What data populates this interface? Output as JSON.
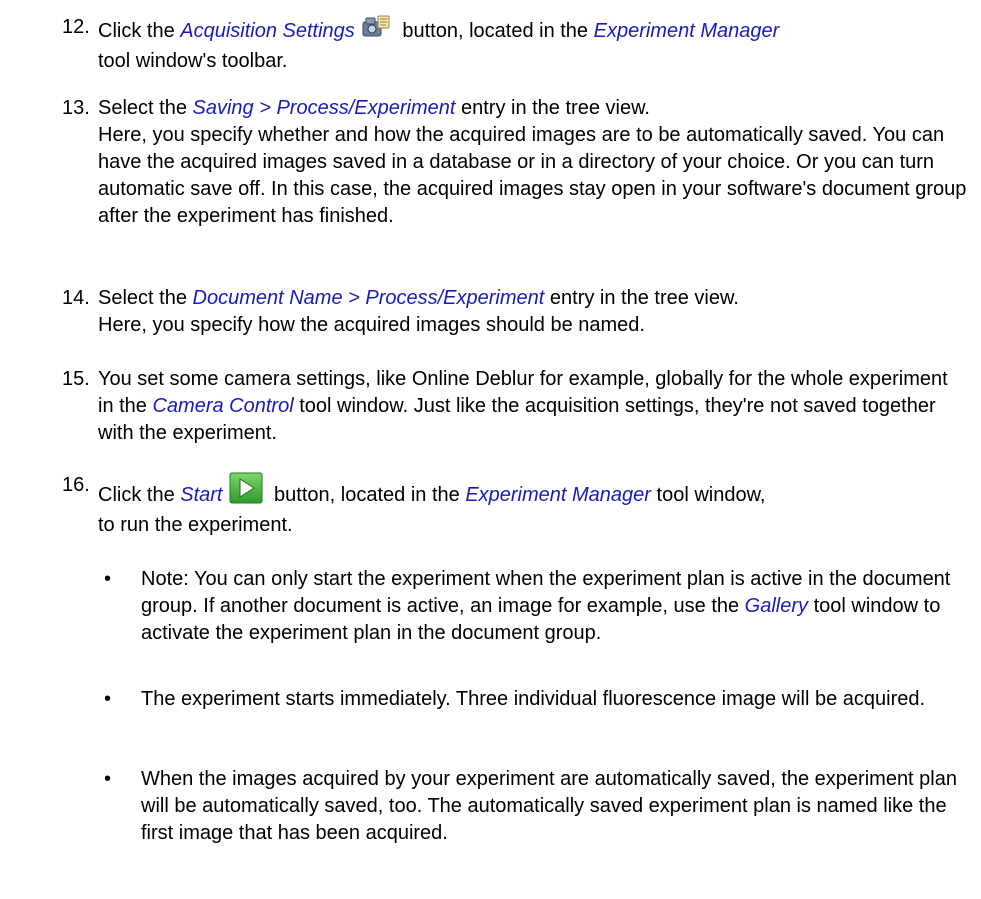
{
  "steps": [
    {
      "number": "12.",
      "parts": [
        "Click the ",
        "Acquisition Settings",
        " button, located in the ",
        "Experiment Manager",
        " tool window's toolbar."
      ],
      "icon": "acquisition-settings-icon"
    },
    {
      "number": "13.",
      "parts": [
        "Select the ",
        "Saving > Process/Experiment",
        " entry in the tree view.",
        "Here, you specify whether and how the acquired images are to be automatically saved. You can have the acquired images saved in a database or in a directory of your choice. Or you can turn automatic save off. In this case, the acquired images stay open in your software's document group after the experiment has finished."
      ]
    },
    {
      "number": "14.",
      "parts": [
        "Select the ",
        "Document Name > Process/Experiment",
        " entry in the tree view.",
        "Here, you specify how the acquired images should be named."
      ]
    },
    {
      "number": "15.",
      "parts": [
        "You set some camera settings, like Online Deblur for example, globally for the whole experiment in the ",
        "Camera Control",
        " tool window. Just like the acquisition settings, they're not saved together with the experiment."
      ]
    },
    {
      "number": "16.",
      "parts": [
        "Click the ",
        "Start",
        " button, located in the ",
        "Experiment Manager",
        " tool window,",
        "to run the experiment."
      ],
      "icon": "start-play-icon"
    }
  ],
  "bullets": [
    {
      "parts": [
        "Note: You can only start the experiment when the experiment plan is active in the document group. If another document is active, an image for example, use the ",
        "Gallery",
        " tool window to activate the experiment plan in the document group."
      ]
    },
    {
      "parts": [
        "The experiment starts immediately. Three individual fluorescence image will be acquired."
      ]
    },
    {
      "parts": [
        "When the images acquired by your experiment are automatically saved, the experiment plan will be automatically saved, too. The automatically saved experiment plan is named like the first image that has been acquired."
      ]
    }
  ],
  "bullet_glyph": "•",
  "colors": {
    "link": "#1a1ab8",
    "text": "#000000",
    "start_icon_green": "#3fae3a"
  }
}
